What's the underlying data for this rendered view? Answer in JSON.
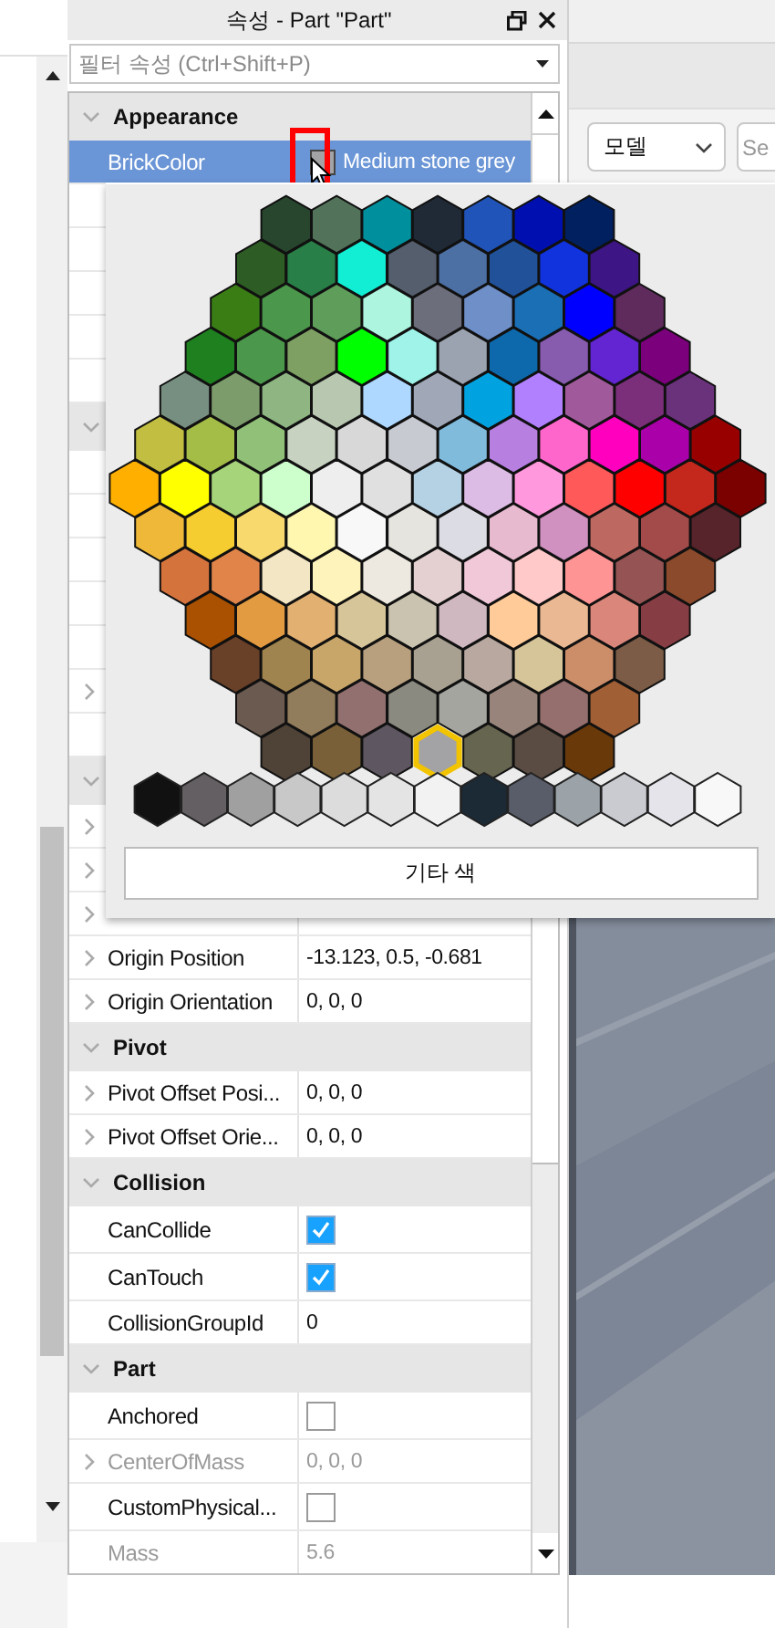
{
  "panel": {
    "title": "속성 - Part \"Part\""
  },
  "filter": {
    "placeholder": "필터 속성 (Ctrl+Shift+P)"
  },
  "properties": [
    {
      "kind": "header",
      "name": "Appearance",
      "expanded": true
    },
    {
      "kind": "color",
      "name": "BrickColor",
      "value": "Medium stone grey",
      "color": "#a3a2a5",
      "selected": true,
      "highlighted": true,
      "expandable": false
    },
    {
      "kind": "covered",
      "expandable": false,
      "selected": false
    },
    {
      "kind": "covered",
      "expandable": false,
      "selected": false
    },
    {
      "kind": "covered",
      "expandable": false,
      "selected": false
    },
    {
      "kind": "covered",
      "expandable": false,
      "selected": false
    },
    {
      "kind": "covered",
      "expandable": false,
      "selected": false
    },
    {
      "kind": "covered_header",
      "expanded": true
    },
    {
      "kind": "covered",
      "expandable": false,
      "selected": false
    },
    {
      "kind": "covered",
      "expandable": false,
      "selected": false
    },
    {
      "kind": "covered",
      "expandable": false,
      "selected": false
    },
    {
      "kind": "covered",
      "expandable": false,
      "selected": false
    },
    {
      "kind": "covered",
      "expandable": false,
      "selected": false
    },
    {
      "kind": "covered",
      "expandable": true,
      "selected": false
    },
    {
      "kind": "covered",
      "expandable": false,
      "selected": false
    },
    {
      "kind": "covered_header",
      "expanded": true
    },
    {
      "kind": "covered",
      "expandable": true,
      "selected": false
    },
    {
      "kind": "covered",
      "expandable": true,
      "selected": false
    },
    {
      "kind": "covered",
      "expandable": true,
      "selected": false
    },
    {
      "kind": "text",
      "name": "Origin Position",
      "value": "-13.123, 0.5, -0.681",
      "expandable": true,
      "selected": false,
      "disabled": false
    },
    {
      "kind": "text",
      "name": "Origin Orientation",
      "value": "0, 0, 0",
      "expandable": true,
      "selected": false,
      "disabled": false
    },
    {
      "kind": "header",
      "name": "Pivot",
      "expanded": true
    },
    {
      "kind": "text",
      "name": "Pivot Offset Posi...",
      "value": "0, 0, 0",
      "expandable": true,
      "selected": false,
      "disabled": false
    },
    {
      "kind": "text",
      "name": "Pivot Offset Orie...",
      "value": "0, 0, 0",
      "expandable": true,
      "selected": false,
      "disabled": false
    },
    {
      "kind": "header",
      "name": "Collision",
      "expanded": true
    },
    {
      "kind": "check",
      "name": "CanCollide",
      "checked": true,
      "expandable": false,
      "selected": false,
      "disabled": false
    },
    {
      "kind": "check",
      "name": "CanTouch",
      "checked": true,
      "expandable": false,
      "selected": false,
      "disabled": false
    },
    {
      "kind": "text",
      "name": "CollisionGroupId",
      "value": "0",
      "expandable": false,
      "selected": false,
      "disabled": false
    },
    {
      "kind": "header",
      "name": "Part",
      "expanded": true
    },
    {
      "kind": "check",
      "name": "Anchored",
      "checked": false,
      "expandable": false,
      "selected": false,
      "disabled": false
    },
    {
      "kind": "text",
      "name": "CenterOfMass",
      "value": "0, 0, 0",
      "expandable": true,
      "selected": false,
      "disabled": true
    },
    {
      "kind": "check",
      "name": "CustomPhysical...",
      "checked": false,
      "expandable": false,
      "selected": false,
      "disabled": false
    },
    {
      "kind": "text",
      "name": "Mass",
      "value": "5.6",
      "expandable": false,
      "selected": false,
      "disabled": true
    }
  ],
  "palette": {
    "rows": [
      [
        {
          "color": "#27462d",
          "selected": false
        },
        {
          "color": "#52735a",
          "selected": false
        },
        {
          "color": "#008f9c",
          "selected": false
        },
        {
          "color": "#1f2a36",
          "selected": false
        },
        {
          "color": "#2154b9",
          "selected": false
        },
        {
          "color": "#0010b0",
          "selected": false
        },
        {
          "color": "#002060",
          "selected": false
        }
      ],
      [
        {
          "color": "#2d5d24",
          "selected": false
        },
        {
          "color": "#287f47",
          "selected": false
        },
        {
          "color": "#12eed4",
          "selected": false
        },
        {
          "color": "#555e6c",
          "selected": false
        },
        {
          "color": "#4c6fa4",
          "selected": false
        },
        {
          "color": "#215299",
          "selected": false
        },
        {
          "color": "#1133dd",
          "selected": false
        },
        {
          "color": "#3d1585",
          "selected": false
        }
      ],
      [
        {
          "color": "#3a7d15",
          "selected": false
        },
        {
          "color": "#4b974b",
          "selected": false
        },
        {
          "color": "#5f9e5a",
          "selected": false
        },
        {
          "color": "#aef5e0",
          "selected": false
        },
        {
          "color": "#6d6e7c",
          "selected": false
        },
        {
          "color": "#6e8fc8",
          "selected": false
        },
        {
          "color": "#1b6fb5",
          "selected": false
        },
        {
          "color": "#0000ff",
          "selected": false
        },
        {
          "color": "#5f2b5d",
          "selected": false
        }
      ],
      [
        {
          "color": "#1f8020",
          "selected": false
        },
        {
          "color": "#4b974b",
          "selected": false
        },
        {
          "color": "#7ea063",
          "selected": false
        },
        {
          "color": "#00ff00",
          "selected": false
        },
        {
          "color": "#9ff3e9",
          "selected": false
        },
        {
          "color": "#9ca3b0",
          "selected": false
        },
        {
          "color": "#0d69ac",
          "selected": false
        },
        {
          "color": "#875bae",
          "selected": false
        },
        {
          "color": "#6225d1",
          "selected": false
        },
        {
          "color": "#7b007b",
          "selected": false
        }
      ],
      [
        {
          "color": "#778f80",
          "selected": false
        },
        {
          "color": "#7c9c6b",
          "selected": false
        },
        {
          "color": "#8eb582",
          "selected": false
        },
        {
          "color": "#b7c7b0",
          "selected": false
        },
        {
          "color": "#aed8ff",
          "selected": false
        },
        {
          "color": "#a0a8b8",
          "selected": false
        },
        {
          "color": "#00a2e0",
          "selected": false
        },
        {
          "color": "#b080ff",
          "selected": false
        },
        {
          "color": "#a05a9b",
          "selected": false
        },
        {
          "color": "#7b2f7b",
          "selected": false
        },
        {
          "color": "#6b327c",
          "selected": false
        }
      ],
      [
        {
          "color": "#c1be42",
          "selected": false
        },
        {
          "color": "#a4bd47",
          "selected": false
        },
        {
          "color": "#91c078",
          "selected": false
        },
        {
          "color": "#c7d2c0",
          "selected": false
        },
        {
          "color": "#d8d8d8",
          "selected": false
        },
        {
          "color": "#c7cad0",
          "selected": false
        },
        {
          "color": "#80bbdb",
          "selected": false
        },
        {
          "color": "#b77fe0",
          "selected": false
        },
        {
          "color": "#ff66cc",
          "selected": false
        },
        {
          "color": "#ff00bf",
          "selected": false
        },
        {
          "color": "#aa00aa",
          "selected": false
        },
        {
          "color": "#980000",
          "selected": false
        }
      ],
      [
        {
          "color": "#ffaf00",
          "selected": false
        },
        {
          "color": "#ffff00",
          "selected": false
        },
        {
          "color": "#a5d47a",
          "selected": false
        },
        {
          "color": "#ccffcc",
          "selected": false
        },
        {
          "color": "#eeeeee",
          "selected": false
        },
        {
          "color": "#e0e0e0",
          "selected": false
        },
        {
          "color": "#b4d2e4",
          "selected": false
        },
        {
          "color": "#dcbce4",
          "selected": false
        },
        {
          "color": "#ff98dc",
          "selected": false
        },
        {
          "color": "#ff5959",
          "selected": false
        },
        {
          "color": "#ff0000",
          "selected": false
        },
        {
          "color": "#c4281c",
          "selected": false
        },
        {
          "color": "#7b0000",
          "selected": false
        }
      ],
      [
        {
          "color": "#efb838",
          "selected": false
        },
        {
          "color": "#f5cd30",
          "selected": false
        },
        {
          "color": "#f8d96d",
          "selected": false
        },
        {
          "color": "#fff7b0",
          "selected": false
        },
        {
          "color": "#f8f8f8",
          "selected": false
        },
        {
          "color": "#e5e4df",
          "selected": false
        },
        {
          "color": "#dcdce4",
          "selected": false
        },
        {
          "color": "#e8bad0",
          "selected": false
        },
        {
          "color": "#d090c0",
          "selected": false
        },
        {
          "color": "#be6862",
          "selected": false
        },
        {
          "color": "#a34b4b",
          "selected": false
        },
        {
          "color": "#56242a",
          "selected": false
        }
      ],
      [
        {
          "color": "#d5733d",
          "selected": false
        },
        {
          "color": "#e0844a",
          "selected": false
        },
        {
          "color": "#f2e6c4",
          "selected": false
        },
        {
          "color": "#fef3bb",
          "selected": false
        },
        {
          "color": "#ede9e0",
          "selected": false
        },
        {
          "color": "#e4d0d0",
          "selected": false
        },
        {
          "color": "#f0c8d8",
          "selected": false
        },
        {
          "color": "#ffc9c9",
          "selected": false
        },
        {
          "color": "#ff9494",
          "selected": false
        },
        {
          "color": "#955353",
          "selected": false
        },
        {
          "color": "#8b4a2b",
          "selected": false
        }
      ],
      [
        {
          "color": "#a95100",
          "selected": false
        },
        {
          "color": "#e29b40",
          "selected": false
        },
        {
          "color": "#e2b070",
          "selected": false
        },
        {
          "color": "#d7c59a",
          "selected": false
        },
        {
          "color": "#cac3b0",
          "selected": false
        },
        {
          "color": "#d0b8c0",
          "selected": false
        },
        {
          "color": "#ffcc99",
          "selected": false
        },
        {
          "color": "#eab892",
          "selected": false
        },
        {
          "color": "#da867a",
          "selected": false
        },
        {
          "color": "#873d44",
          "selected": false
        }
      ],
      [
        {
          "color": "#694028",
          "selected": false
        },
        {
          "color": "#a0844f",
          "selected": false
        },
        {
          "color": "#c8a66a",
          "selected": false
        },
        {
          "color": "#b8a07e",
          "selected": false
        },
        {
          "color": "#a8a090",
          "selected": false
        },
        {
          "color": "#b8a8a0",
          "selected": false
        },
        {
          "color": "#d7c59a",
          "selected": false
        },
        {
          "color": "#cc8e69",
          "selected": false
        },
        {
          "color": "#7c5c46",
          "selected": false
        }
      ],
      [
        {
          "color": "#6b5a4f",
          "selected": false
        },
        {
          "color": "#917c5b",
          "selected": false
        },
        {
          "color": "#927070",
          "selected": false
        },
        {
          "color": "#8a8a80",
          "selected": false
        },
        {
          "color": "#a5a5a0",
          "selected": false
        },
        {
          "color": "#98847a",
          "selected": false
        },
        {
          "color": "#956f6d",
          "selected": false
        },
        {
          "color": "#a05f35",
          "selected": false
        }
      ],
      [
        {
          "color": "#4f4237",
          "selected": false
        },
        {
          "color": "#7a6038",
          "selected": false
        },
        {
          "color": "#5e5660",
          "selected": false
        },
        {
          "color": "#a3a2a5",
          "selected": true
        },
        {
          "color": "#666550",
          "selected": false
        },
        {
          "color": "#5a4c42",
          "selected": false
        },
        {
          "color": "#6a3909",
          "selected": false
        }
      ]
    ],
    "grays": [
      {
        "color": "#111111",
        "selected": false
      },
      {
        "color": "#635f62",
        "selected": false
      },
      {
        "color": "#a0a0a0",
        "selected": false
      },
      {
        "color": "#c8c8c8",
        "selected": false
      },
      {
        "color": "#dcdcdc",
        "selected": false
      },
      {
        "color": "#e4e4e4",
        "selected": false
      },
      {
        "color": "#f2f2f2",
        "selected": false
      },
      {
        "color": "#1b2a35",
        "selected": false
      },
      {
        "color": "#595d69",
        "selected": false
      },
      {
        "color": "#9ca3a8",
        "selected": false
      },
      {
        "color": "#c9cbd1",
        "selected": false
      },
      {
        "color": "#e5e4ea",
        "selected": false
      },
      {
        "color": "#f8f8f8",
        "selected": false
      }
    ],
    "more_button": "기타 색"
  },
  "toolbar": {
    "dropdown": "모델",
    "search_placeholder": "Se"
  }
}
